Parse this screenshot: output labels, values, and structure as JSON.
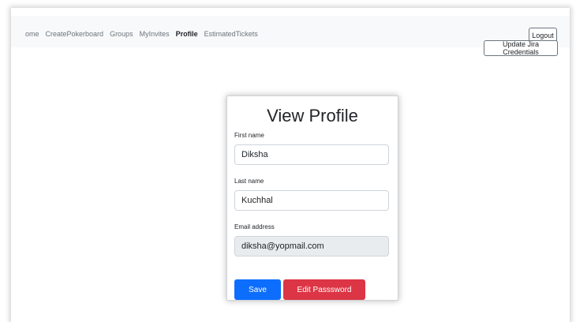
{
  "navbar": {
    "links": [
      {
        "label": "ome",
        "active": false
      },
      {
        "label": "CreatePokerboard",
        "active": false
      },
      {
        "label": "Groups",
        "active": false
      },
      {
        "label": "MyInvites",
        "active": false
      },
      {
        "label": "Profile",
        "active": true
      },
      {
        "label": "EstimatedTickets",
        "active": false
      }
    ],
    "logout_label": "Logout",
    "jira_label": "Update Jira Credentials"
  },
  "profile": {
    "title": "View Profile",
    "first_name_label": "First name",
    "first_name_value": "Diksha",
    "last_name_label": "Last name",
    "last_name_value": "Kuchhal",
    "email_label": "Email address",
    "email_value": "diksha@yopmail.com",
    "save_label": "Save",
    "edit_password_label": "Edit Passsword"
  },
  "colors": {
    "primary": "#0d6efd",
    "danger": "#dc3545",
    "navbar_bg": "#f8f9fa",
    "disabled_field_bg": "#e9ecef"
  }
}
